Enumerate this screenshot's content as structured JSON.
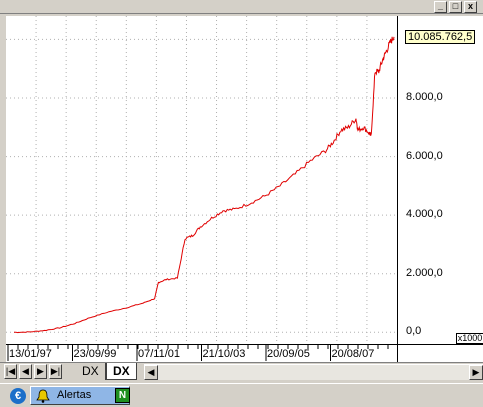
{
  "window": {
    "title_fragment": "",
    "controls": {
      "minimize": "_",
      "maximize": "□",
      "close": "x"
    }
  },
  "chart_data": {
    "type": "line",
    "x": [
      "13/01/97",
      "23/09/99",
      "07/11/01",
      "21/10/03",
      "20/09/05",
      "20/08/07"
    ],
    "xlabel": "",
    "ylabel": "",
    "y_tick_labels": [
      "0,0",
      "2.000,0",
      "4.000,0",
      "6.000,0",
      "8.000,0"
    ],
    "ylim": [
      -400,
      10800
    ],
    "scale_note": "x1000",
    "last_value_label": "10.085.762,5",
    "grid": true,
    "series": [
      {
        "color": "#e00000",
        "points": [
          [
            0.0,
            0
          ],
          [
            0.04,
            10
          ],
          [
            0.08,
            60
          ],
          [
            0.12,
            150
          ],
          [
            0.16,
            300
          ],
          [
            0.2,
            500
          ],
          [
            0.25,
            700
          ],
          [
            0.3,
            850
          ],
          [
            0.34,
            1000
          ],
          [
            0.37,
            1150
          ],
          [
            0.38,
            1700
          ],
          [
            0.4,
            1800
          ],
          [
            0.43,
            1850
          ],
          [
            0.45,
            3200
          ],
          [
            0.47,
            3300
          ],
          [
            0.49,
            3600
          ],
          [
            0.52,
            3900
          ],
          [
            0.55,
            4150
          ],
          [
            0.58,
            4200
          ],
          [
            0.62,
            4400
          ],
          [
            0.66,
            4650
          ],
          [
            0.7,
            5000
          ],
          [
            0.74,
            5400
          ],
          [
            0.78,
            5850
          ],
          [
            0.82,
            6200
          ],
          [
            0.84,
            6500
          ],
          [
            0.86,
            6900
          ],
          [
            0.88,
            7000
          ],
          [
            0.9,
            7300
          ],
          [
            0.905,
            6900
          ],
          [
            0.92,
            7000
          ],
          [
            0.935,
            6800
          ],
          [
            0.94,
            6700
          ],
          [
            0.95,
            8900
          ],
          [
            0.96,
            8900
          ],
          [
            0.97,
            9300
          ],
          [
            0.98,
            9600
          ],
          [
            0.99,
            9900
          ],
          [
            1.0,
            10085
          ]
        ]
      }
    ]
  },
  "tabs": [
    {
      "label": "DX"
    },
    {
      "label": "DX"
    }
  ],
  "nav": {
    "first": "|◀",
    "prev": "◀",
    "next": "▶",
    "last": "▶|"
  },
  "statusbar": {
    "alerts_label": "Alertas",
    "news_label": "N",
    "euro_label": "€"
  }
}
